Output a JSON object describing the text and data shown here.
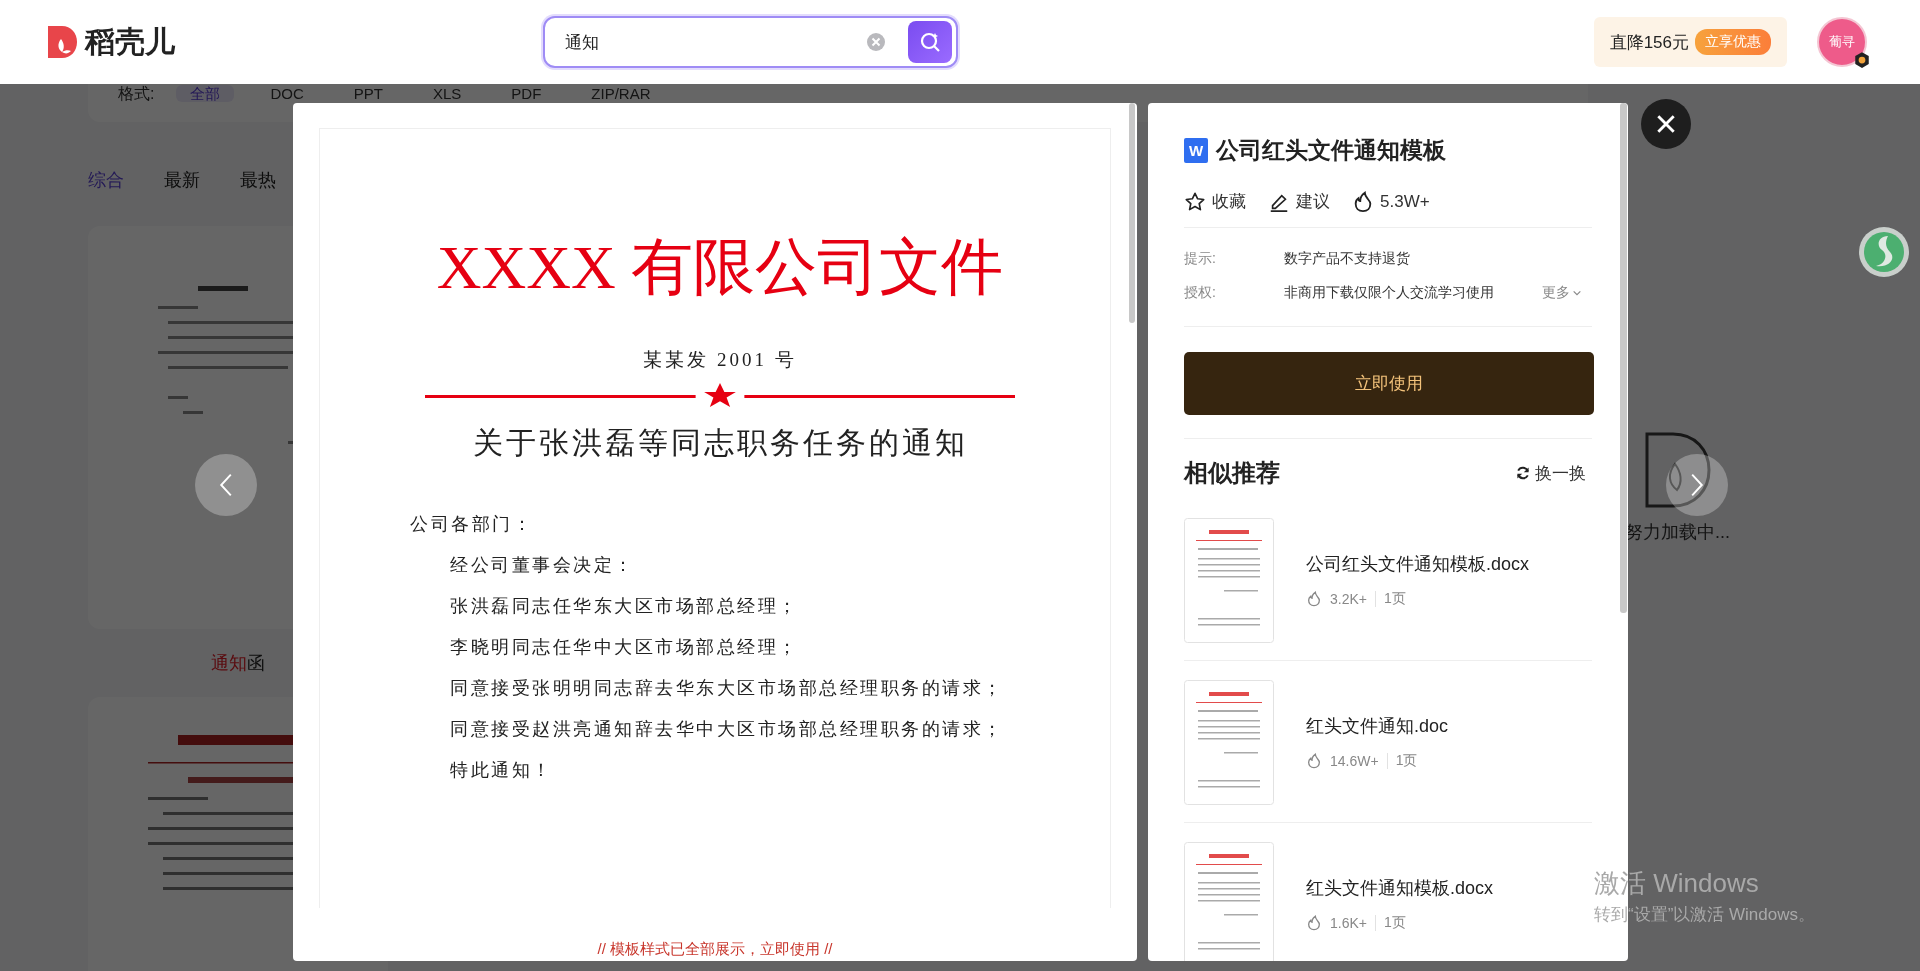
{
  "header": {
    "logo": "稻壳儿",
    "search": {
      "value": "通知"
    },
    "promo": {
      "text": "直降156元",
      "badge": "立享优惠"
    },
    "avatar": {
      "label": "葡寻"
    }
  },
  "background": {
    "filter": {
      "label": "格式:",
      "options": [
        {
          "label": "全部",
          "selected": true
        },
        {
          "label": "DOC",
          "selected": false
        },
        {
          "label": "PPT",
          "selected": false
        },
        {
          "label": "XLS",
          "selected": false
        },
        {
          "label": "PDF",
          "selected": false
        },
        {
          "label": "ZIP/RAR",
          "selected": false
        }
      ]
    },
    "sort_tabs": [
      {
        "label": "综合",
        "selected": true
      },
      {
        "label": "最新",
        "selected": false
      },
      {
        "label": "最热",
        "selected": false
      }
    ],
    "card": {
      "title_highlight": "通知",
      "title_rest": "函"
    },
    "loading": {
      "text": "努力加载中..."
    }
  },
  "preview": {
    "document": {
      "heading": "XXXX 有限公司文件",
      "doc_number": "某某发 2001 号",
      "title": "关于张洪磊等同志职务任务的通知",
      "salutation": "公司各部门：",
      "paragraphs": [
        "经公司董事会决定：",
        "张洪磊同志任华东大区市场部总经理；",
        "李晓明同志任华中大区市场部总经理；",
        "同意接受张明明同志辞去华东大区市场部总经理职务的请求；",
        "同意接受赵洪亮通知辞去华中大区市场部总经理职务的请求；",
        "特此通知！"
      ]
    },
    "footer_note": "// 模板样式已全部展示，立即使用 //"
  },
  "details": {
    "file_type": "W",
    "title": "公司红头文件通知模板",
    "actions": [
      {
        "kind": "favorite",
        "label": "收藏"
      },
      {
        "kind": "suggest",
        "label": "建议"
      },
      {
        "kind": "popularity",
        "label": "5.3W+"
      }
    ],
    "info": [
      {
        "label": "提示:",
        "value": "数字产品不支持退货"
      },
      {
        "label": "授权:",
        "value": "非商用下载仅限个人交流学习使用",
        "more": "更多"
      }
    ],
    "use_button": "立即使用",
    "similar": {
      "heading": "相似推荐",
      "refresh": "换一换",
      "items": [
        {
          "title": "公司红头文件通知模板.docx",
          "heat": "3.2K+",
          "pages": "1页"
        },
        {
          "title": "红头文件通知.doc",
          "heat": "14.6W+",
          "pages": "1页"
        },
        {
          "title": "红头文件通知模板.docx",
          "heat": "1.6K+",
          "pages": "1页"
        }
      ]
    }
  },
  "os_notice": {
    "title": "激活 Windows",
    "subtitle": "转到“设置”以激活 Windows。"
  }
}
